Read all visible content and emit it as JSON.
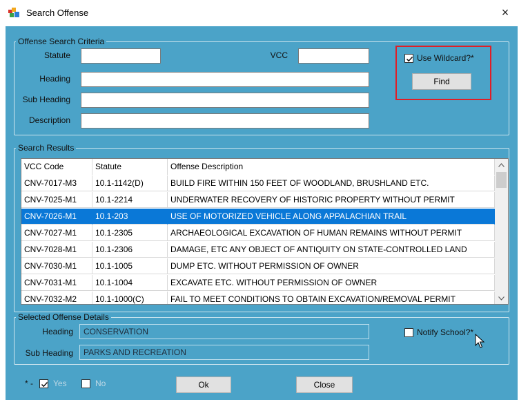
{
  "window": {
    "title": "Search Offense",
    "close_glyph": "×"
  },
  "criteria": {
    "legend": "Offense Search Criteria",
    "statute_label": "Statute",
    "statute_value": "",
    "vcc_label": "VCC",
    "vcc_value": "",
    "heading_label": "Heading",
    "heading_value": "",
    "subheading_label": "Sub Heading",
    "subheading_value": "",
    "description_label": "Description",
    "description_value": "",
    "wildcard_label": "Use Wildcard?*",
    "wildcard_checked": true,
    "find_label": "Find"
  },
  "results": {
    "legend": "Search Results",
    "columns": [
      "VCC Code",
      "Statute",
      "Offense Description"
    ],
    "selected_index": 2,
    "rows": [
      [
        "CNV-7017-M3",
        "10.1-1142(D)",
        "BUILD FIRE WITHIN 150 FEET OF WOODLAND, BRUSHLAND ETC."
      ],
      [
        "CNV-7025-M1",
        "10.1-2214",
        "UNDERWATER RECOVERY OF HISTORIC PROPERTY WITHOUT PERMIT"
      ],
      [
        "CNV-7026-M1",
        "10.1-203",
        "USE OF MOTORIZED VEHICLE ALONG APPALACHIAN TRAIL"
      ],
      [
        "CNV-7027-M1",
        "10.1-2305",
        "ARCHAEOLOGICAL EXCAVATION OF HUMAN REMAINS WITHOUT PERMIT"
      ],
      [
        "CNV-7028-M1",
        "10.1-2306",
        "DAMAGE, ETC ANY OBJECT OF ANTIQUITY ON STATE-CONTROLLED LAND"
      ],
      [
        "CNV-7030-M1",
        "10.1-1005",
        "DUMP ETC. WITHOUT PERMISSION OF OWNER"
      ],
      [
        "CNV-7031-M1",
        "10.1-1004",
        "EXCAVATE ETC. WITHOUT PERMISSION OF OWNER"
      ],
      [
        "CNV-7032-M2",
        "10.1-1000(C)",
        "FAIL TO MEET CONDITIONS TO OBTAIN EXCAVATION/REMOVAL PERMIT"
      ]
    ]
  },
  "details": {
    "legend": "Selected Offense Details",
    "heading_label": "Heading",
    "heading_value": "CONSERVATION",
    "subheading_label": "Sub Heading",
    "subheading_value": "PARKS AND RECREATION",
    "notify_label": "Notify School?*",
    "notify_checked": false
  },
  "footer": {
    "legend_prefix": "* -",
    "yes_label": "Yes",
    "no_label": "No",
    "ok_label": "Ok",
    "close_label": "Close"
  },
  "colors": {
    "form_background": "#4ba3c8",
    "selection": "#0a78d7",
    "highlight_border": "#e01e26"
  }
}
